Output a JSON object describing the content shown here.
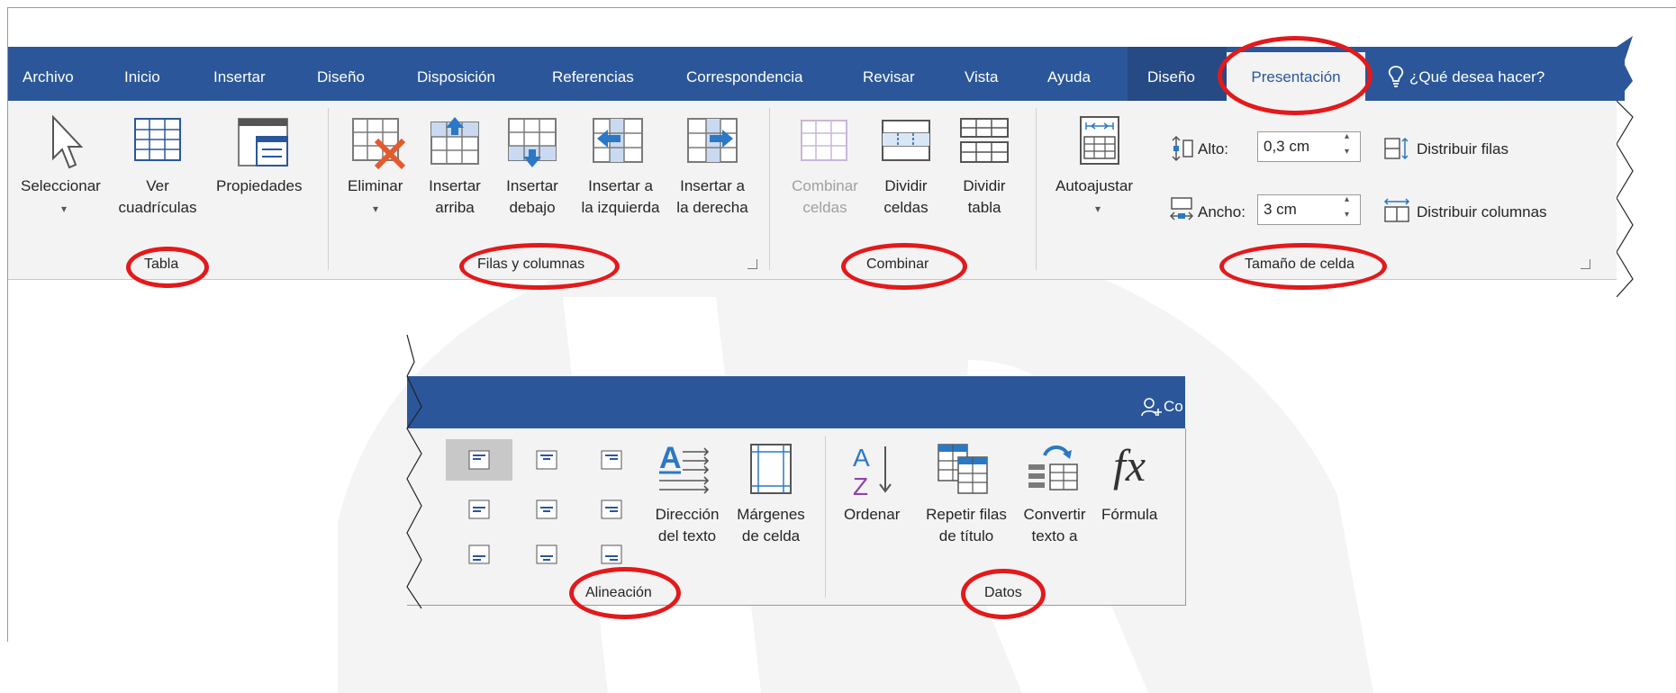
{
  "ribbon_top": {
    "tabs": [
      {
        "label": "Archivo"
      },
      {
        "label": "Inicio"
      },
      {
        "label": "Insertar"
      },
      {
        "label": "Diseño"
      },
      {
        "label": "Disposición"
      },
      {
        "label": "Referencias"
      },
      {
        "label": "Correspondencia"
      },
      {
        "label": "Revisar"
      },
      {
        "label": "Vista"
      },
      {
        "label": "Ayuda"
      },
      {
        "label": "Diseño"
      },
      {
        "label": "Presentación"
      }
    ],
    "tell_me": "¿Qué desea hacer?",
    "groups": {
      "tabla": {
        "label": "Tabla",
        "seleccionar": "Seleccionar",
        "ver_1": "Ver",
        "ver_2": "cuadrículas",
        "propiedades": "Propiedades"
      },
      "filas": {
        "label": "Filas y columnas",
        "eliminar": "Eliminar",
        "arriba_1": "Insertar",
        "arriba_2": "arriba",
        "debajo_1": "Insertar",
        "debajo_2": "debajo",
        "izq_1": "Insertar a",
        "izq_2": "la izquierda",
        "der_1": "Insertar a",
        "der_2": "la derecha"
      },
      "combinar": {
        "label": "Combinar",
        "comb_1": "Combinar",
        "comb_2": "celdas",
        "divc_1": "Dividir",
        "divc_2": "celdas",
        "divt_1": "Dividir",
        "divt_2": "tabla"
      },
      "tamano": {
        "label": "Tamaño de celda",
        "autoajustar": "Autoajustar",
        "alto_label": "Alto:",
        "alto_value": "0,3 cm",
        "ancho_label": "Ancho:",
        "ancho_value": "3 cm",
        "dist_filas": "Distribuir filas",
        "dist_columnas": "Distribuir columnas"
      }
    }
  },
  "ribbon_bottom": {
    "share_partial": "Co",
    "groups": {
      "alineacion": {
        "label": "Alineación",
        "dir_1": "Dirección",
        "dir_2": "del texto",
        "marg_1": "Márgenes",
        "marg_2": "de celda"
      },
      "datos": {
        "label": "Datos",
        "ordenar": "Ordenar",
        "rep_1": "Repetir filas",
        "rep_2": "de título",
        "conv_1": "Convertir",
        "conv_2": "texto a",
        "formula": "Fórmula"
      }
    }
  },
  "colors": {
    "ribbon_blue": "#2b579a",
    "annotation_red": "#e3191b",
    "ribbon_bg": "#f3f3f3"
  }
}
